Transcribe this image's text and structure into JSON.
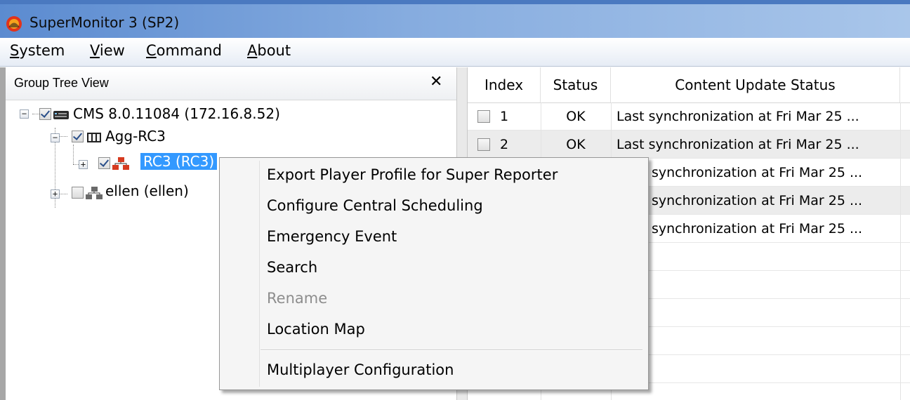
{
  "window": {
    "title": "SuperMonitor 3 (SP2)"
  },
  "menubar": {
    "items": [
      {
        "accel": "S",
        "rest": "ystem"
      },
      {
        "accel": "V",
        "rest": "iew"
      },
      {
        "accel": "C",
        "rest": "ommand"
      },
      {
        "accel": "A",
        "rest": "bout"
      }
    ]
  },
  "left_panel": {
    "title": "Group Tree View",
    "close_glyph": "✕",
    "tree": [
      {
        "label": "CMS  8.0.11084  (172.16.8.52)",
        "checked": true,
        "expander": "−",
        "icon": "server-icon"
      },
      {
        "label": "Agg-RC3",
        "checked": true,
        "expander": "−",
        "icon": "aggregator-icon"
      },
      {
        "label": "RC3  (RC3)",
        "checked": true,
        "expander": "+",
        "icon": "network-group-icon",
        "selected": true
      },
      {
        "label": "ellen  (ellen)",
        "checked": false,
        "expander": "+",
        "icon": "network-group-icon"
      }
    ]
  },
  "grid": {
    "columns": [
      "Index",
      "Status",
      "Content Update Status"
    ],
    "rows": [
      {
        "index": "1",
        "status": "OK",
        "content": "Last synchronization at Fri Mar 25 ..."
      },
      {
        "index": "2",
        "status": "OK",
        "content": "Last synchronization at Fri Mar 25 ..."
      },
      {
        "index": "",
        "status": "",
        "content": "synchronization at Fri Mar 25 ..."
      },
      {
        "index": "",
        "status": "",
        "content": "synchronization at Fri Mar 25 ..."
      },
      {
        "index": "",
        "status": "",
        "content": "synchronization at Fri Mar 25 ..."
      }
    ]
  },
  "context_menu": {
    "items": [
      {
        "label": "Export Player Profile for Super Reporter",
        "enabled": true
      },
      {
        "label": "Configure Central Scheduling",
        "enabled": true
      },
      {
        "label": "Emergency Event",
        "enabled": true
      },
      {
        "label": "Search",
        "enabled": true
      },
      {
        "label": "Rename",
        "enabled": false
      },
      {
        "label": "Location Map",
        "enabled": true
      },
      {
        "label": "Multiplayer Configuration",
        "enabled": true
      }
    ]
  },
  "colors": {
    "selection": "#3399ff",
    "title_bar": "#5b8bd0",
    "disabled_text": "#8d8d8d"
  }
}
